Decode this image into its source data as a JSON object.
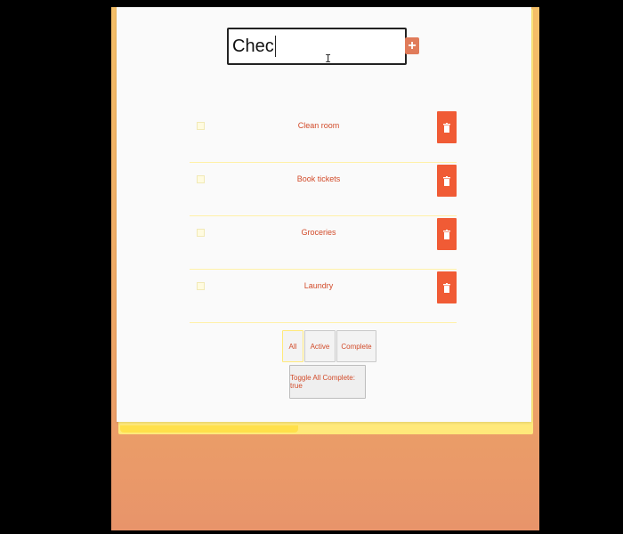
{
  "input": {
    "value": "Chec",
    "placeholder": ""
  },
  "add_button_label": "+",
  "todos": [
    {
      "label": "Clean room",
      "completed": false
    },
    {
      "label": "Book tickets",
      "completed": false
    },
    {
      "label": "Groceries",
      "completed": false
    },
    {
      "label": "Laundry",
      "completed": false
    }
  ],
  "filters": {
    "all": "All",
    "active": "Active",
    "complete": "Complete"
  },
  "toggle_all_label": "Toggle All Complete: true",
  "colors": {
    "accent": "#f05b35",
    "text": "#d24b2a",
    "background": "#f4bf68"
  },
  "icons": {
    "add": "plus-icon",
    "delete": "trash-icon"
  }
}
